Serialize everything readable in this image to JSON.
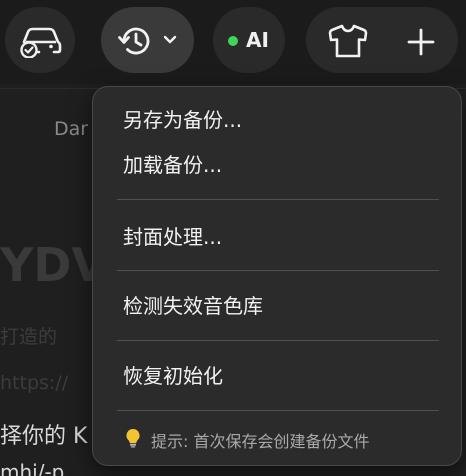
{
  "toolbar": {
    "ai_label": "AI",
    "ai_status_color": "#3fd45a",
    "icons": [
      "car-check-icon",
      "history-icon",
      "chevron-down-icon",
      "shirt-icon",
      "plus-icon"
    ]
  },
  "background": {
    "tab_fragment": "Dar",
    "heading_fragment": "YDV",
    "line_fragment": "打造的",
    "link_fragment": "https://",
    "choose_fragment": "择你的 K",
    "last_fragment": "mhi/-p"
  },
  "menu": {
    "items": [
      {
        "label": "另存为备份..."
      },
      {
        "label": "加载备份..."
      },
      {
        "label": "封面处理..."
      },
      {
        "label": "检测失效音色库"
      },
      {
        "label": "恢复初始化"
      }
    ],
    "hint_icon": "lightbulb-icon",
    "hint_text": "提示: 首次保存会创建备份文件"
  }
}
